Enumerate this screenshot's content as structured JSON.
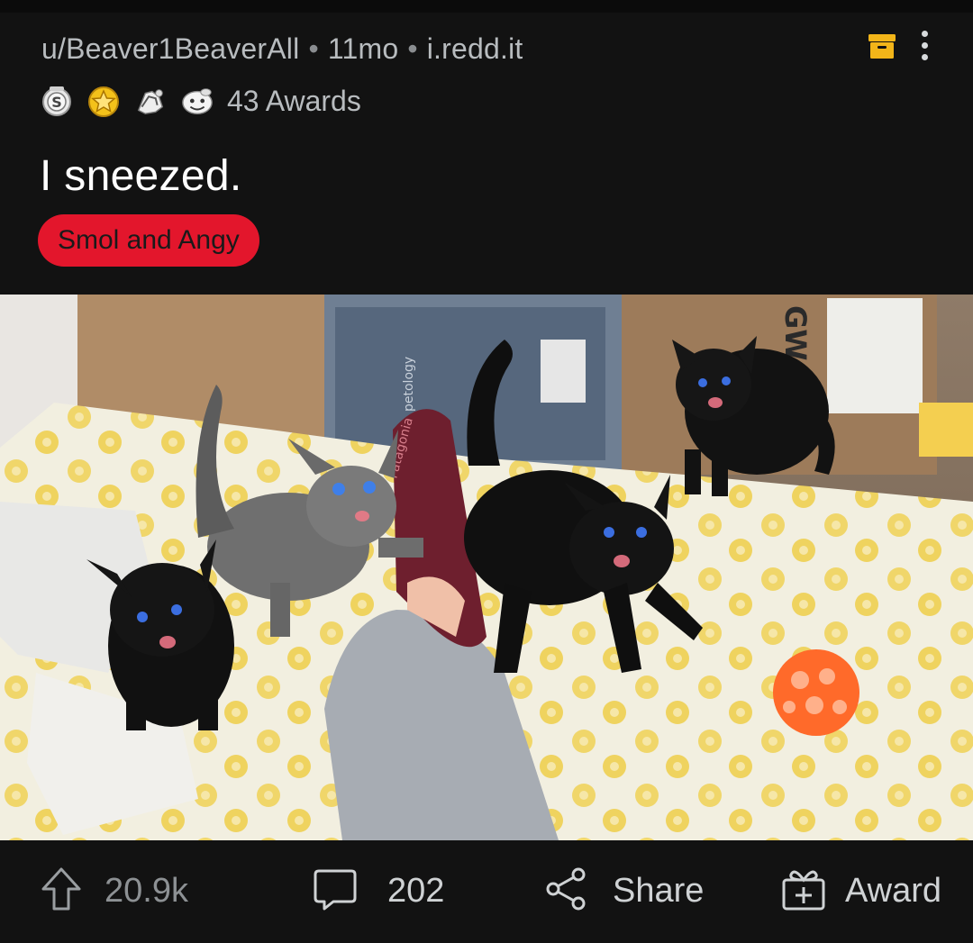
{
  "post": {
    "author": "u/Beaver1BeaverAll",
    "age": "11mo",
    "domain": "i.redd.it",
    "separator": "•",
    "awards_label": "43 Awards",
    "award_icons": [
      "silver-award-icon",
      "gold-star-award-icon",
      "wholesome-seal-award-icon",
      "helpful-award-icon"
    ],
    "title": "I sneezed.",
    "flair": "Smol and Angy"
  },
  "image": {
    "icon": "kittens-photo",
    "box_text": "GW",
    "bin_text": "petology",
    "sock_text": "Patagonia"
  },
  "actions": {
    "upvote_count": "20.9k",
    "comment_count": "202",
    "share_label": "Share",
    "award_label": "Award"
  },
  "colors": {
    "background": "#121212",
    "flair": "#e3162c",
    "save_icon": "#f2b519",
    "text_muted": "#b8bcbf"
  }
}
